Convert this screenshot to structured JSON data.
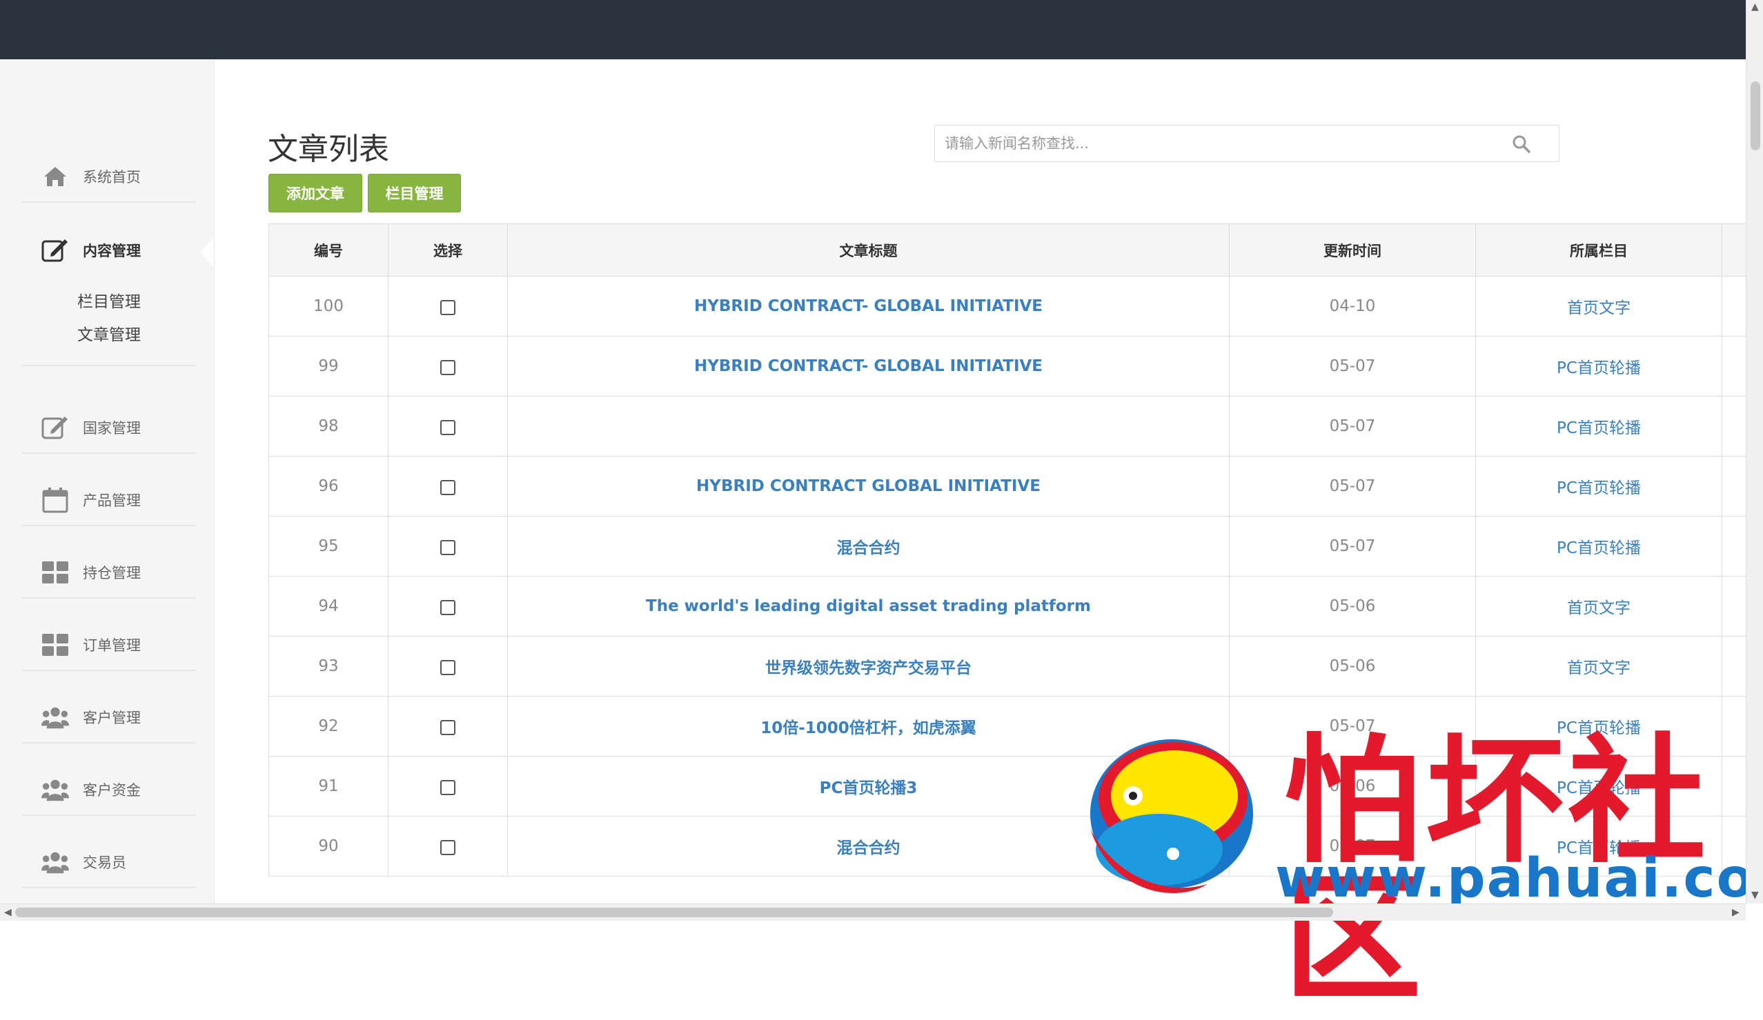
{
  "sidebar": {
    "items": [
      {
        "label": "系统首页",
        "icon": "home-icon"
      },
      {
        "label": "内容管理",
        "icon": "edit-icon"
      },
      {
        "label": "国家管理",
        "icon": "edit-icon"
      },
      {
        "label": "产品管理",
        "icon": "calendar-icon"
      },
      {
        "label": "持仓管理",
        "icon": "grid-icon"
      },
      {
        "label": "订单管理",
        "icon": "grid-icon"
      },
      {
        "label": "客户管理",
        "icon": "users-icon"
      },
      {
        "label": "客户资金",
        "icon": "users-icon"
      },
      {
        "label": "交易员",
        "icon": "users-icon"
      }
    ],
    "subitems": [
      "栏目管理",
      "文章管理"
    ]
  },
  "main": {
    "title": "文章列表",
    "add_button": "添加文章",
    "column_button": "栏目管理",
    "search_placeholder": "请输入新闻名称查找..."
  },
  "table": {
    "headers": [
      "编号",
      "选择",
      "文章标题",
      "更新时间",
      "所属栏目"
    ],
    "rows": [
      {
        "id": "100",
        "title": "HYBRID CONTRACT- GLOBAL INITIATIVE",
        "time": "04-10",
        "category": "首页文字"
      },
      {
        "id": "99",
        "title": "HYBRID CONTRACT- GLOBAL INITIATIVE",
        "time": "05-07",
        "category": "PC首页轮播"
      },
      {
        "id": "98",
        "title": "",
        "time": "05-07",
        "category": "PC首页轮播"
      },
      {
        "id": "96",
        "title": "HYBRID CONTRACT GLOBAL INITIATIVE",
        "time": "05-07",
        "category": "PC首页轮播"
      },
      {
        "id": "95",
        "title": "混合合约",
        "time": "05-07",
        "category": "PC首页轮播"
      },
      {
        "id": "94",
        "title": "The world's leading digital asset trading platform",
        "time": "05-06",
        "category": "首页文字"
      },
      {
        "id": "93",
        "title": "世界级领先数字资产交易平台",
        "time": "05-06",
        "category": "首页文字"
      },
      {
        "id": "92",
        "title": "10倍-1000倍杠杆，如虎添翼",
        "time": "05-07",
        "category": "PC首页轮播"
      },
      {
        "id": "91",
        "title": "PC首页轮播3",
        "time": "05-06",
        "category": "PC首页轮播"
      },
      {
        "id": "90",
        "title": "混合合约",
        "time": "05-07",
        "category": "PC首页轮播"
      }
    ]
  },
  "watermark": {
    "text": "怕坏社区",
    "url": "www.pahuai.com"
  },
  "colors": {
    "topbar": "#2b333e",
    "button": "#87b540",
    "link": "#3a7fbf",
    "watermark_red": "#e21a2c",
    "watermark_blue": "#1977c9"
  }
}
